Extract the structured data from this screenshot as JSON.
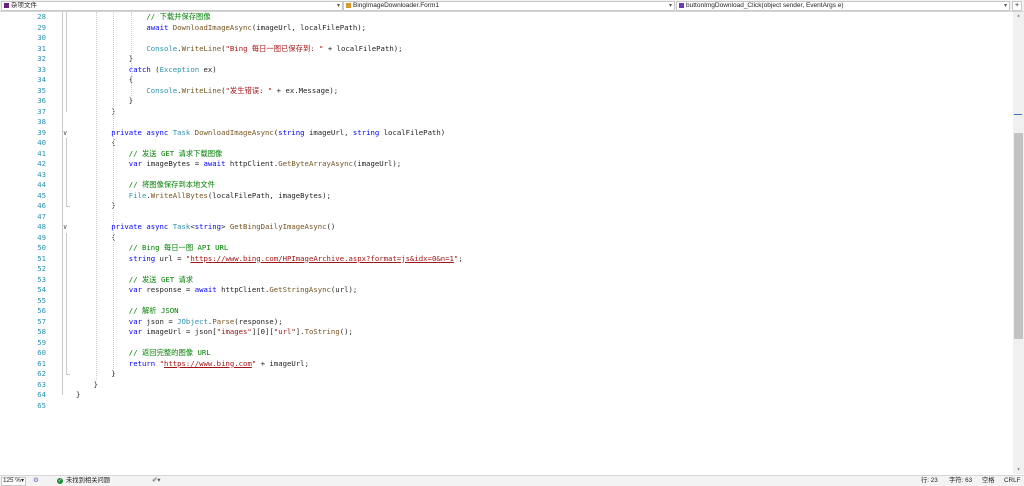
{
  "navbar": {
    "project": "杂项文件",
    "class": "BingImageDownloader.Form1",
    "member": "buttonImgDownload_Click(object sender, EventArgs e)"
  },
  "editor": {
    "lines": [
      {
        "n": "28",
        "indent": 16,
        "tokens": [
          {
            "t": "// 下载并保存图像",
            "c": "cm"
          }
        ]
      },
      {
        "n": "29",
        "indent": 16,
        "tokens": [
          {
            "t": "await",
            "c": "kw"
          },
          {
            "t": " "
          },
          {
            "t": "DownloadImageAsync",
            "c": "mt"
          },
          {
            "t": "(imageUrl, localFilePath);"
          }
        ]
      },
      {
        "n": "30",
        "indent": 0,
        "tokens": []
      },
      {
        "n": "31",
        "indent": 16,
        "tokens": [
          {
            "t": "Console",
            "c": "ty"
          },
          {
            "t": "."
          },
          {
            "t": "WriteLine",
            "c": "mt"
          },
          {
            "t": "("
          },
          {
            "t": "\"Bing 每日一图已保存到: \"",
            "c": "st"
          },
          {
            "t": " + localFilePath);"
          }
        ]
      },
      {
        "n": "32",
        "indent": 12,
        "tokens": [
          {
            "t": "}"
          }
        ]
      },
      {
        "n": "33",
        "indent": 12,
        "tokens": [
          {
            "t": "catch",
            "c": "kw"
          },
          {
            "t": " ("
          },
          {
            "t": "Exception",
            "c": "ty"
          },
          {
            "t": " ex)"
          }
        ]
      },
      {
        "n": "34",
        "indent": 12,
        "tokens": [
          {
            "t": "{"
          }
        ]
      },
      {
        "n": "35",
        "indent": 16,
        "tokens": [
          {
            "t": "Console",
            "c": "ty"
          },
          {
            "t": "."
          },
          {
            "t": "WriteLine",
            "c": "mt"
          },
          {
            "t": "("
          },
          {
            "t": "\"发生错误: \"",
            "c": "st"
          },
          {
            "t": " + ex.Message);"
          }
        ]
      },
      {
        "n": "36",
        "indent": 12,
        "tokens": [
          {
            "t": "}"
          }
        ]
      },
      {
        "n": "37",
        "indent": 8,
        "tokens": [
          {
            "t": "}"
          }
        ]
      },
      {
        "n": "38",
        "indent": 0,
        "tokens": []
      },
      {
        "n": "39",
        "indent": 8,
        "tokens": [
          {
            "t": "private",
            "c": "kw"
          },
          {
            "t": " "
          },
          {
            "t": "async",
            "c": "kw"
          },
          {
            "t": " "
          },
          {
            "t": "Task",
            "c": "ty"
          },
          {
            "t": " "
          },
          {
            "t": "DownloadImageAsync",
            "c": "mt"
          },
          {
            "t": "("
          },
          {
            "t": "string",
            "c": "kw"
          },
          {
            "t": " imageUrl, "
          },
          {
            "t": "string",
            "c": "kw"
          },
          {
            "t": " localFilePath)"
          }
        ]
      },
      {
        "n": "40",
        "indent": 8,
        "tokens": [
          {
            "t": "{"
          }
        ]
      },
      {
        "n": "41",
        "indent": 12,
        "tokens": [
          {
            "t": "// 发送 GET 请求下载图像",
            "c": "cm"
          }
        ]
      },
      {
        "n": "42",
        "indent": 12,
        "tokens": [
          {
            "t": "var",
            "c": "kw"
          },
          {
            "t": " imageBytes = "
          },
          {
            "t": "await",
            "c": "kw"
          },
          {
            "t": " httpClient."
          },
          {
            "t": "GetByteArrayAsync",
            "c": "mt"
          },
          {
            "t": "(imageUrl);"
          }
        ]
      },
      {
        "n": "43",
        "indent": 0,
        "tokens": []
      },
      {
        "n": "44",
        "indent": 12,
        "tokens": [
          {
            "t": "// 将图像保存到本地文件",
            "c": "cm"
          }
        ]
      },
      {
        "n": "45",
        "indent": 12,
        "tokens": [
          {
            "t": "File",
            "c": "ty"
          },
          {
            "t": "."
          },
          {
            "t": "WriteAllBytes",
            "c": "mt"
          },
          {
            "t": "(localFilePath, imageBytes);"
          }
        ]
      },
      {
        "n": "46",
        "indent": 8,
        "tokens": [
          {
            "t": "}"
          }
        ]
      },
      {
        "n": "47",
        "indent": 0,
        "tokens": []
      },
      {
        "n": "48",
        "indent": 8,
        "tokens": [
          {
            "t": "private",
            "c": "kw"
          },
          {
            "t": " "
          },
          {
            "t": "async",
            "c": "kw"
          },
          {
            "t": " "
          },
          {
            "t": "Task",
            "c": "ty"
          },
          {
            "t": "<"
          },
          {
            "t": "string",
            "c": "kw"
          },
          {
            "t": "> "
          },
          {
            "t": "GetBingDailyImageAsync",
            "c": "mt"
          },
          {
            "t": "()"
          }
        ]
      },
      {
        "n": "49",
        "indent": 8,
        "tokens": [
          {
            "t": "{"
          }
        ]
      },
      {
        "n": "50",
        "indent": 12,
        "tokens": [
          {
            "t": "// Bing 每日一图 API URL",
            "c": "cm"
          }
        ]
      },
      {
        "n": "51",
        "indent": 12,
        "tokens": [
          {
            "t": "string",
            "c": "kw"
          },
          {
            "t": " url = "
          },
          {
            "t": "\"",
            "c": "st"
          },
          {
            "t": "https://www.bing.com/HPImageArchive.aspx?format=js&idx=0&n=1",
            "c": "url"
          },
          {
            "t": "\"",
            "c": "st"
          },
          {
            "t": ";"
          }
        ]
      },
      {
        "n": "52",
        "indent": 0,
        "tokens": []
      },
      {
        "n": "53",
        "indent": 12,
        "tokens": [
          {
            "t": "// 发送 GET 请求",
            "c": "cm"
          }
        ]
      },
      {
        "n": "54",
        "indent": 12,
        "tokens": [
          {
            "t": "var",
            "c": "kw"
          },
          {
            "t": " response = "
          },
          {
            "t": "await",
            "c": "kw"
          },
          {
            "t": " httpClient."
          },
          {
            "t": "GetStringAsync",
            "c": "mt"
          },
          {
            "t": "(url);"
          }
        ]
      },
      {
        "n": "55",
        "indent": 0,
        "tokens": []
      },
      {
        "n": "56",
        "indent": 12,
        "tokens": [
          {
            "t": "// 解析 JSON",
            "c": "cm"
          }
        ]
      },
      {
        "n": "57",
        "indent": 12,
        "tokens": [
          {
            "t": "var",
            "c": "kw"
          },
          {
            "t": " json = "
          },
          {
            "t": "JObject",
            "c": "ty"
          },
          {
            "t": "."
          },
          {
            "t": "Parse",
            "c": "mt"
          },
          {
            "t": "(response);"
          }
        ]
      },
      {
        "n": "58",
        "indent": 12,
        "tokens": [
          {
            "t": "var",
            "c": "kw"
          },
          {
            "t": " imageUrl = json["
          },
          {
            "t": "\"images\"",
            "c": "st"
          },
          {
            "t": "][0]["
          },
          {
            "t": "\"url\"",
            "c": "st"
          },
          {
            "t": "]."
          },
          {
            "t": "ToString",
            "c": "mt"
          },
          {
            "t": "();"
          }
        ]
      },
      {
        "n": "59",
        "indent": 0,
        "tokens": []
      },
      {
        "n": "60",
        "indent": 12,
        "tokens": [
          {
            "t": "// 返回完整的图像 URL",
            "c": "cm"
          }
        ]
      },
      {
        "n": "61",
        "indent": 12,
        "tokens": [
          {
            "t": "return",
            "c": "kw"
          },
          {
            "t": " "
          },
          {
            "t": "\"",
            "c": "st"
          },
          {
            "t": "https://www.bing.com",
            "c": "url"
          },
          {
            "t": "\"",
            "c": "st"
          },
          {
            "t": " + imageUrl;"
          }
        ]
      },
      {
        "n": "62",
        "indent": 8,
        "tokens": [
          {
            "t": "}"
          }
        ]
      },
      {
        "n": "63",
        "indent": 4,
        "tokens": [
          {
            "t": "}"
          }
        ]
      },
      {
        "n": "64",
        "indent": 0,
        "tokens": [
          {
            "t": "}"
          }
        ]
      },
      {
        "n": "65",
        "indent": 0,
        "tokens": []
      }
    ],
    "fold_markers": [
      "39",
      "48"
    ]
  },
  "statusbar": {
    "zoom": "125 %",
    "issues": "未找到相关问题",
    "line": "行: 23",
    "col": "字符: 63",
    "spacing": "空格",
    "eol": "CRLF"
  },
  "colors": {
    "keyword": "#0000ff",
    "type": "#2b91af",
    "string": "#a31515",
    "comment": "#008000",
    "line_number": "#2b91af"
  }
}
